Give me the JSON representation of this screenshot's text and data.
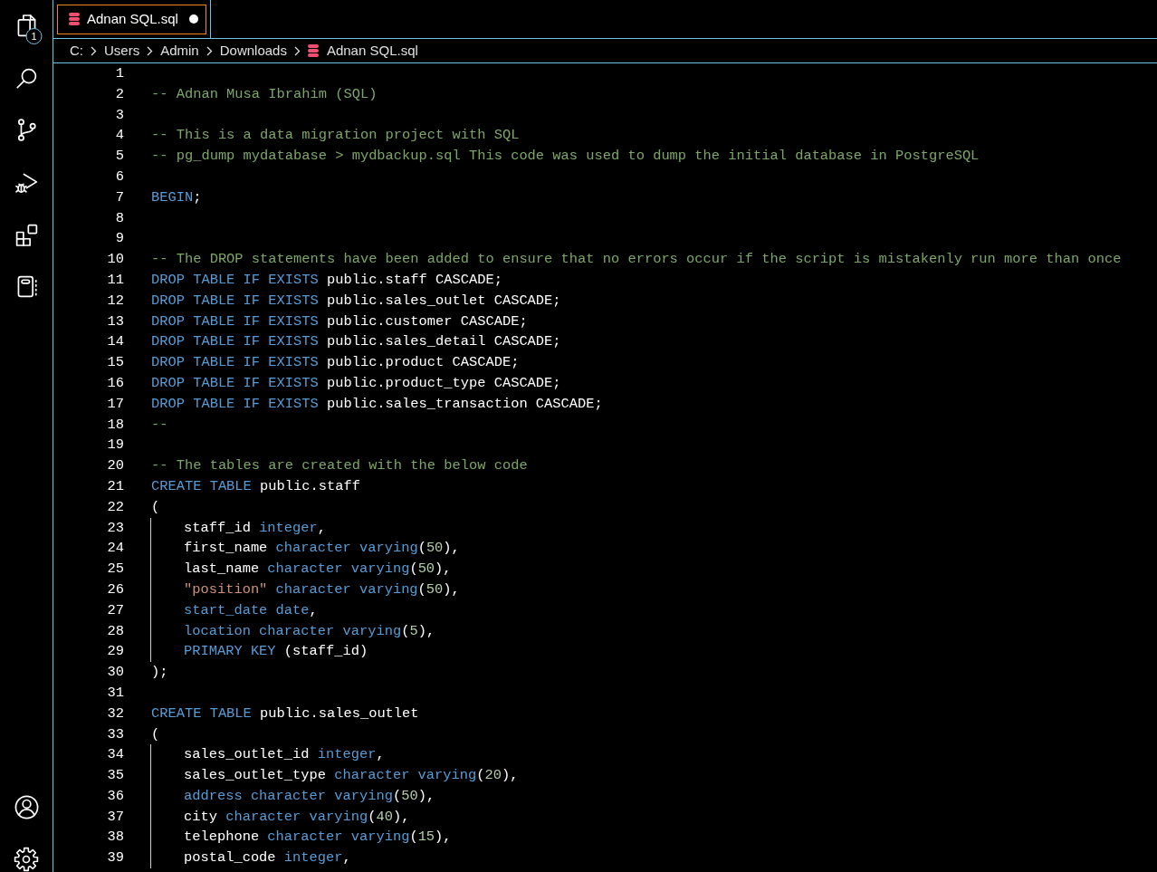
{
  "activity_bar": {
    "top": [
      {
        "kind": "files",
        "badge": "1"
      },
      {
        "kind": "search"
      },
      {
        "kind": "source_control"
      },
      {
        "kind": "run_debug"
      },
      {
        "kind": "extensions"
      },
      {
        "kind": "notebook"
      }
    ],
    "bottom": [
      {
        "kind": "account"
      },
      {
        "kind": "settings"
      }
    ]
  },
  "tabs": [
    {
      "label": "Adnan SQL.sql",
      "selected": true,
      "modified": true
    }
  ],
  "breadcrumbs": [
    {
      "label": "C:",
      "kind": "folder"
    },
    {
      "label": "Users",
      "kind": "folder"
    },
    {
      "label": "Admin",
      "kind": "folder"
    },
    {
      "label": "Downloads",
      "kind": "folder"
    },
    {
      "label": "Adnan SQL.sql",
      "kind": "file"
    }
  ],
  "editor": {
    "lines": [
      {
        "number": "1"
      },
      {
        "number": "2",
        "tokens": [
          {
            "kind": "comment",
            "text": "-- Adnan Musa Ibrahim (SQL)"
          }
        ]
      },
      {
        "number": "3"
      },
      {
        "number": "4",
        "tokens": [
          {
            "kind": "comment",
            "text": "-- This is a data migration project with SQL"
          }
        ]
      },
      {
        "number": "5",
        "tokens": [
          {
            "kind": "comment",
            "text": "-- pg_dump mydatabase > mydbackup.sql This code was used to dump the initial database in PostgreSQL"
          }
        ]
      },
      {
        "number": "6"
      },
      {
        "number": "7",
        "tokens": [
          {
            "kind": "keyword",
            "text": "BEGIN"
          },
          {
            "kind": "plain",
            "text": ";"
          }
        ]
      },
      {
        "number": "8"
      },
      {
        "number": "9"
      },
      {
        "number": "10",
        "tokens": [
          {
            "kind": "comment",
            "text": "-- The DROP statements have been added to ensure that no errors occur if the script is mistakenly run more than once"
          }
        ]
      },
      {
        "number": "11",
        "tokens": [
          {
            "kind": "keyword",
            "text": "DROP TABLE IF EXISTS"
          },
          {
            "kind": "plain",
            "text": " public.staff CASCADE;"
          }
        ]
      },
      {
        "number": "12",
        "tokens": [
          {
            "kind": "keyword",
            "text": "DROP TABLE IF EXISTS"
          },
          {
            "kind": "plain",
            "text": " public.sales_outlet CASCADE;"
          }
        ]
      },
      {
        "number": "13",
        "tokens": [
          {
            "kind": "keyword",
            "text": "DROP TABLE IF EXISTS"
          },
          {
            "kind": "plain",
            "text": " public.customer CASCADE;"
          }
        ]
      },
      {
        "number": "14",
        "tokens": [
          {
            "kind": "keyword",
            "text": "DROP TABLE IF EXISTS"
          },
          {
            "kind": "plain",
            "text": " public.sales_detail CASCADE;"
          }
        ]
      },
      {
        "number": "15",
        "tokens": [
          {
            "kind": "keyword",
            "text": "DROP TABLE IF EXISTS"
          },
          {
            "kind": "plain",
            "text": " public.product CASCADE;"
          }
        ]
      },
      {
        "number": "16",
        "tokens": [
          {
            "kind": "keyword",
            "text": "DROP TABLE IF EXISTS"
          },
          {
            "kind": "plain",
            "text": " public.product_type CASCADE;"
          }
        ]
      },
      {
        "number": "17",
        "tokens": [
          {
            "kind": "keyword",
            "text": "DROP TABLE IF EXISTS"
          },
          {
            "kind": "plain",
            "text": " public.sales_transaction CASCADE;"
          }
        ]
      },
      {
        "number": "18",
        "tokens": [
          {
            "kind": "comment",
            "text": "--"
          }
        ]
      },
      {
        "number": "19"
      },
      {
        "number": "20",
        "tokens": [
          {
            "kind": "comment",
            "text": "-- The tables are created with the below code"
          }
        ]
      },
      {
        "number": "21",
        "tokens": [
          {
            "kind": "keyword",
            "text": "CREATE TABLE"
          },
          {
            "kind": "plain",
            "text": " public.staff"
          }
        ]
      },
      {
        "number": "22",
        "tokens": [
          {
            "kind": "plain",
            "text": "("
          }
        ],
        "children": [
          {
            "number": "23",
            "tokens": [
              {
                "kind": "plain",
                "text": "staff_id "
              },
              {
                "kind": "keyword",
                "text": "integer"
              },
              {
                "kind": "plain",
                "text": ","
              }
            ]
          },
          {
            "number": "24",
            "tokens": [
              {
                "kind": "plain",
                "text": "first_name "
              },
              {
                "kind": "keyword",
                "text": "character varying"
              },
              {
                "kind": "plain",
                "text": "("
              },
              {
                "kind": "number",
                "text": "50"
              },
              {
                "kind": "plain",
                "text": "),"
              }
            ]
          },
          {
            "number": "25",
            "tokens": [
              {
                "kind": "plain",
                "text": "last_name "
              },
              {
                "kind": "keyword",
                "text": "character varying"
              },
              {
                "kind": "plain",
                "text": "("
              },
              {
                "kind": "number",
                "text": "50"
              },
              {
                "kind": "plain",
                "text": "),"
              }
            ]
          },
          {
            "number": "26",
            "tokens": [
              {
                "kind": "string",
                "text": "\"position\""
              },
              {
                "kind": "keyword",
                "text": " character varying"
              },
              {
                "kind": "plain",
                "text": "("
              },
              {
                "kind": "number",
                "text": "50"
              },
              {
                "kind": "plain",
                "text": "),"
              }
            ]
          },
          {
            "number": "27",
            "tokens": [
              {
                "kind": "keyword",
                "text": "start_date date"
              },
              {
                "kind": "plain",
                "text": ","
              }
            ]
          },
          {
            "number": "28",
            "tokens": [
              {
                "kind": "keyword",
                "text": "location character varying"
              },
              {
                "kind": "plain",
                "text": "("
              },
              {
                "kind": "number",
                "text": "5"
              },
              {
                "kind": "plain",
                "text": "),"
              }
            ]
          },
          {
            "number": "29",
            "tokens": [
              {
                "kind": "keyword",
                "text": "PRIMARY KEY"
              },
              {
                "kind": "plain",
                "text": " (staff_id)"
              }
            ]
          }
        ]
      },
      {
        "number": "30",
        "tokens": [
          {
            "kind": "plain",
            "text": ");"
          }
        ]
      },
      {
        "number": "31"
      },
      {
        "number": "32",
        "tokens": [
          {
            "kind": "keyword",
            "text": "CREATE TABLE"
          },
          {
            "kind": "plain",
            "text": " public.sales_outlet"
          }
        ]
      },
      {
        "number": "33",
        "tokens": [
          {
            "kind": "plain",
            "text": "("
          }
        ],
        "children": [
          {
            "number": "34",
            "tokens": [
              {
                "kind": "plain",
                "text": "sales_outlet_id "
              },
              {
                "kind": "keyword",
                "text": "integer"
              },
              {
                "kind": "plain",
                "text": ","
              }
            ]
          },
          {
            "number": "35",
            "tokens": [
              {
                "kind": "plain",
                "text": "sales_outlet_type "
              },
              {
                "kind": "keyword",
                "text": "character varying"
              },
              {
                "kind": "plain",
                "text": "("
              },
              {
                "kind": "number",
                "text": "20"
              },
              {
                "kind": "plain",
                "text": "),"
              }
            ]
          },
          {
            "number": "36",
            "tokens": [
              {
                "kind": "keyword",
                "text": "address character varying"
              },
              {
                "kind": "plain",
                "text": "("
              },
              {
                "kind": "number",
                "text": "50"
              },
              {
                "kind": "plain",
                "text": "),"
              }
            ]
          },
          {
            "number": "37",
            "tokens": [
              {
                "kind": "plain",
                "text": "city "
              },
              {
                "kind": "keyword",
                "text": "character varying"
              },
              {
                "kind": "plain",
                "text": "("
              },
              {
                "kind": "number",
                "text": "40"
              },
              {
                "kind": "plain",
                "text": "),"
              }
            ]
          },
          {
            "number": "38",
            "tokens": [
              {
                "kind": "plain",
                "text": "telephone "
              },
              {
                "kind": "keyword",
                "text": "character varying"
              },
              {
                "kind": "plain",
                "text": "("
              },
              {
                "kind": "number",
                "text": "15"
              },
              {
                "kind": "plain",
                "text": "),"
              }
            ]
          },
          {
            "number": "39",
            "tokens": [
              {
                "kind": "plain",
                "text": "postal_code "
              },
              {
                "kind": "keyword",
                "text": "integer"
              },
              {
                "kind": "plain",
                "text": ","
              }
            ]
          }
        ]
      }
    ]
  }
}
